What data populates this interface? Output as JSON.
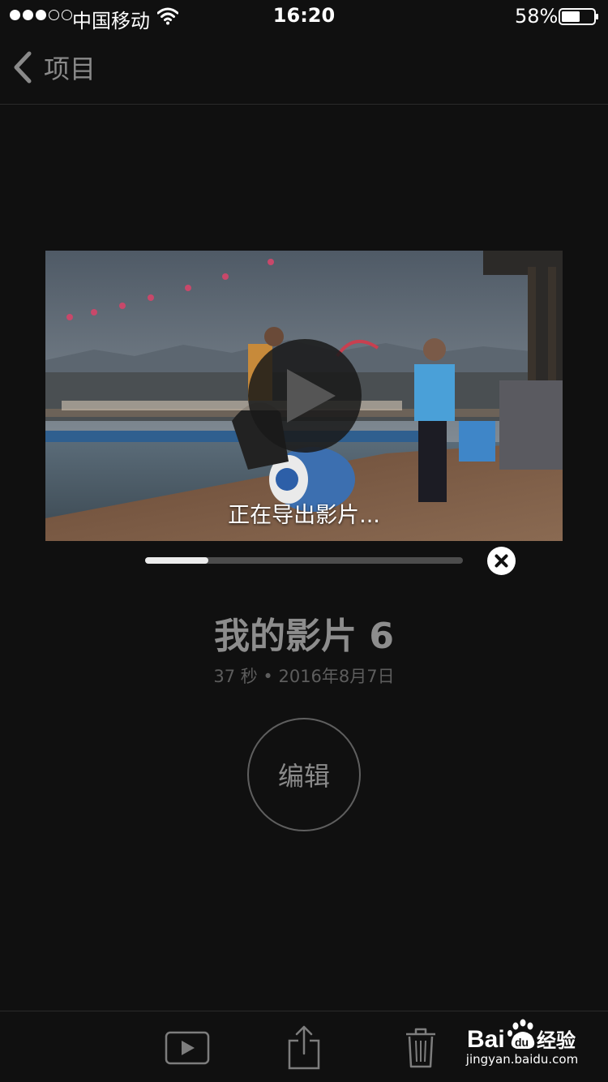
{
  "status_bar": {
    "carrier": "中国移动",
    "time": "16:20",
    "battery_percent": "58%",
    "battery_level": 0.58,
    "signal_dots_filled": 3,
    "signal_dots_total": 5
  },
  "nav": {
    "back_label": "项目",
    "back_icon": "chevron-left-icon"
  },
  "player": {
    "export_status": "正在导出影片...",
    "export_progress": 0.2,
    "play_icon": "play-icon",
    "cancel_icon": "close-icon"
  },
  "movie": {
    "title": "我的影片 6",
    "meta": "37 秒 • 2016年8月7日"
  },
  "edit_button_label": "编辑",
  "toolbar": {
    "play_icon": "play-icon",
    "share_icon": "share-icon",
    "trash_icon": "trash-icon"
  },
  "watermark": {
    "logo_text": "Bai du 经验",
    "url": "jingyan.baidu.com"
  },
  "colors": {
    "background": "#101010",
    "secondary_text": "#8a8a8a",
    "progress_fill": "#ececec",
    "progress_track": "#4d4d4d"
  }
}
